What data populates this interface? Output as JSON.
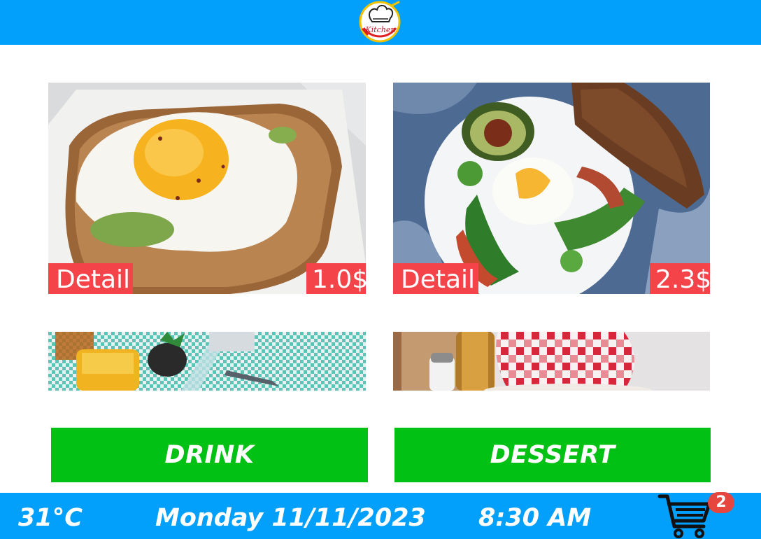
{
  "header": {
    "logo_text": "Kitchen",
    "logo_icon": "chef-hat-icon"
  },
  "menu_items": [
    {
      "detail_label": "Detail",
      "price": "1.0$",
      "image": "fried-egg-toast"
    },
    {
      "detail_label": "Detail",
      "price": "2.3$",
      "image": "poached-egg-salad"
    },
    {
      "image": "orange-juice-table"
    },
    {
      "image": "picnic-table"
    }
  ],
  "categories": {
    "drink_label": "DRINK",
    "dessert_label": "DESSERT"
  },
  "status": {
    "temperature": "31°C",
    "date": "Monday 11/11/2023",
    "time": "8:30 AM",
    "cart_count": "2",
    "cart_icon": "shopping-cart-icon"
  },
  "colors": {
    "bar_blue": "#03a0fb",
    "tag_red": "#f5434a",
    "button_green": "#02c115",
    "badge_red": "#e5473f"
  }
}
